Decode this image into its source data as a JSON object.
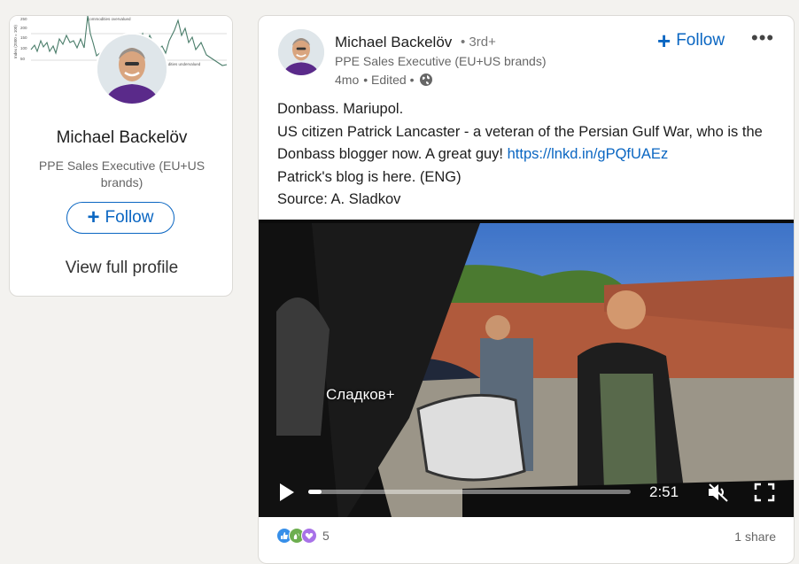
{
  "profile_card": {
    "cover_chart": {
      "label_top": "Commodities overvalued",
      "label_bottom": "Commodities undervalued",
      "ylabel": "Index (2000 = 100)",
      "yticks": [
        "250",
        "200",
        "150",
        "100",
        "50"
      ]
    },
    "name": "Michael Backelöv",
    "headline": "PPE Sales Executive (EU+US brands)",
    "follow_label": "Follow",
    "view_profile_label": "View full profile"
  },
  "post": {
    "author_name": "Michael Backelöv",
    "degree": "• 3rd+",
    "author_headline": "PPE Sales Executive (EU+US brands)",
    "time": "4mo",
    "edited": "• Edited •",
    "follow_label": "Follow",
    "more_label": "•••",
    "text": {
      "line1": "Donbass. Mariupol.",
      "line2": "US citizen Patrick Lancaster - a veteran of the Persian Gulf War, who is the Donbass blogger now. A great guy!",
      "link": "https://lnkd.in/gPQfUAEz",
      "line3": "Patrick's blog is here. (ENG)",
      "line4": "Source: A. Sladkov"
    },
    "video": {
      "watermark": "Сладков+",
      "duration": "2:51",
      "progress": 0.04
    },
    "reaction_count": "5",
    "shares": "1 share"
  },
  "colors": {
    "accent": "#0a66c2",
    "background": "#f3f2ef",
    "like": "#378fe9",
    "celebrate": "#6dae4f",
    "support": "#a872e8"
  },
  "icons": {
    "globe": "globe-icon",
    "play": "play-icon",
    "mute": "mute-icon",
    "fullscreen": "fullscreen-icon",
    "more": "more-icon"
  }
}
